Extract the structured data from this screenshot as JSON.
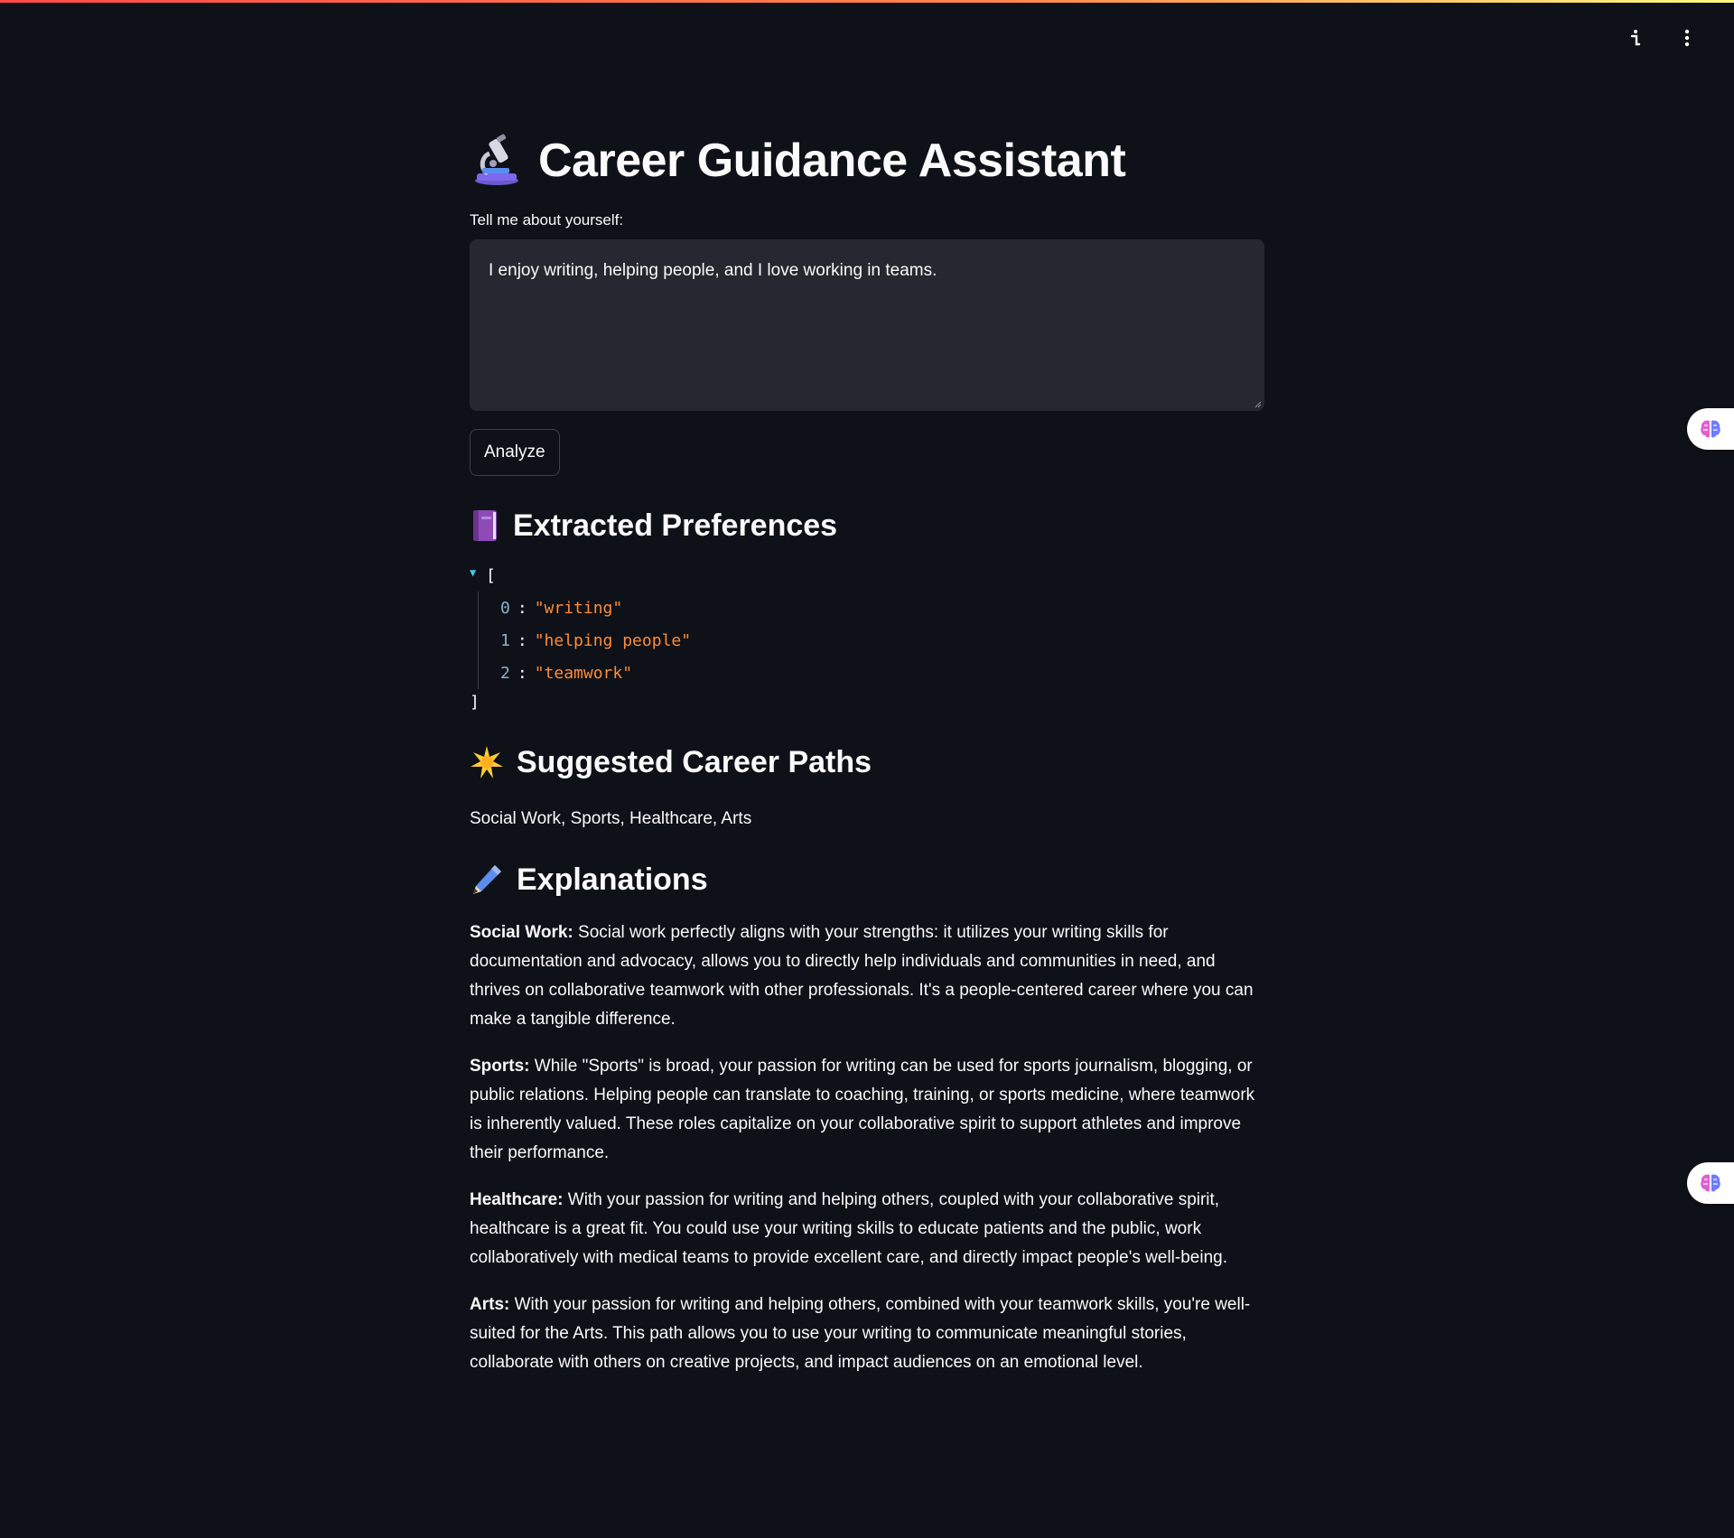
{
  "header": {
    "actions": [
      {
        "icon": "info-icon"
      },
      {
        "icon": "more-vertical-icon"
      }
    ]
  },
  "side_widgets": [
    {
      "icon": "brain-icon"
    },
    {
      "icon": "brain-icon"
    }
  ],
  "title": {
    "emoji": "microscope-icon",
    "text": "Career Guidance Assistant"
  },
  "input": {
    "label": "Tell me about yourself:",
    "value": "I enjoy writing, helping people, and I love working in teams."
  },
  "analyze_button": {
    "label": "Analyze"
  },
  "preferences": {
    "heading": "Extracted Preferences",
    "emoji": "book-icon",
    "open_bracket": "[",
    "close_bracket": "]",
    "items": [
      {
        "key": "0",
        "value": "\"writing\""
      },
      {
        "key": "1",
        "value": "\"helping people\""
      },
      {
        "key": "2",
        "value": "\"teamwork\""
      }
    ]
  },
  "careers": {
    "heading": "Suggested Career Paths",
    "emoji": "sparkle-icon",
    "list_text": "Social Work, Sports, Healthcare, Arts"
  },
  "explanations": {
    "heading": "Explanations",
    "emoji": "pencil-icon",
    "items": [
      {
        "title": "Social Work:",
        "text": "Social work perfectly aligns with your strengths: it utilizes your writing skills for documentation and advocacy, allows you to directly help individuals and communities in need, and thrives on collaborative teamwork with other professionals. It's a people-centered career where you can make a tangible difference."
      },
      {
        "title": "Sports:",
        "text": "While \"Sports\" is broad, your passion for writing can be used for sports journalism, blogging, or public relations. Helping people can translate to coaching, training, or sports medicine, where teamwork is inherently valued. These roles capitalize on your collaborative spirit to support athletes and improve their performance."
      },
      {
        "title": "Healthcare:",
        "text": "With your passion for writing and helping others, coupled with your collaborative spirit, healthcare is a great fit. You could use your writing skills to educate patients and the public, work collaboratively with medical teams to provide excellent care, and directly impact people's well-being."
      },
      {
        "title": "Arts:",
        "text": "With your passion for writing and helping others, combined with your teamwork skills, you're well-suited for the Arts. This path allows you to use your writing to communicate meaningful stories, collaborate with others on creative projects, and impact audiences on an emotional level."
      }
    ]
  },
  "colors": {
    "background": "#0e1117",
    "input_bg": "#262730",
    "json_string": "#ff8c3a",
    "json_key": "#8ab4c8",
    "accent_gradient_start": "#ff4b4b",
    "accent_gradient_end": "#fffd80"
  }
}
